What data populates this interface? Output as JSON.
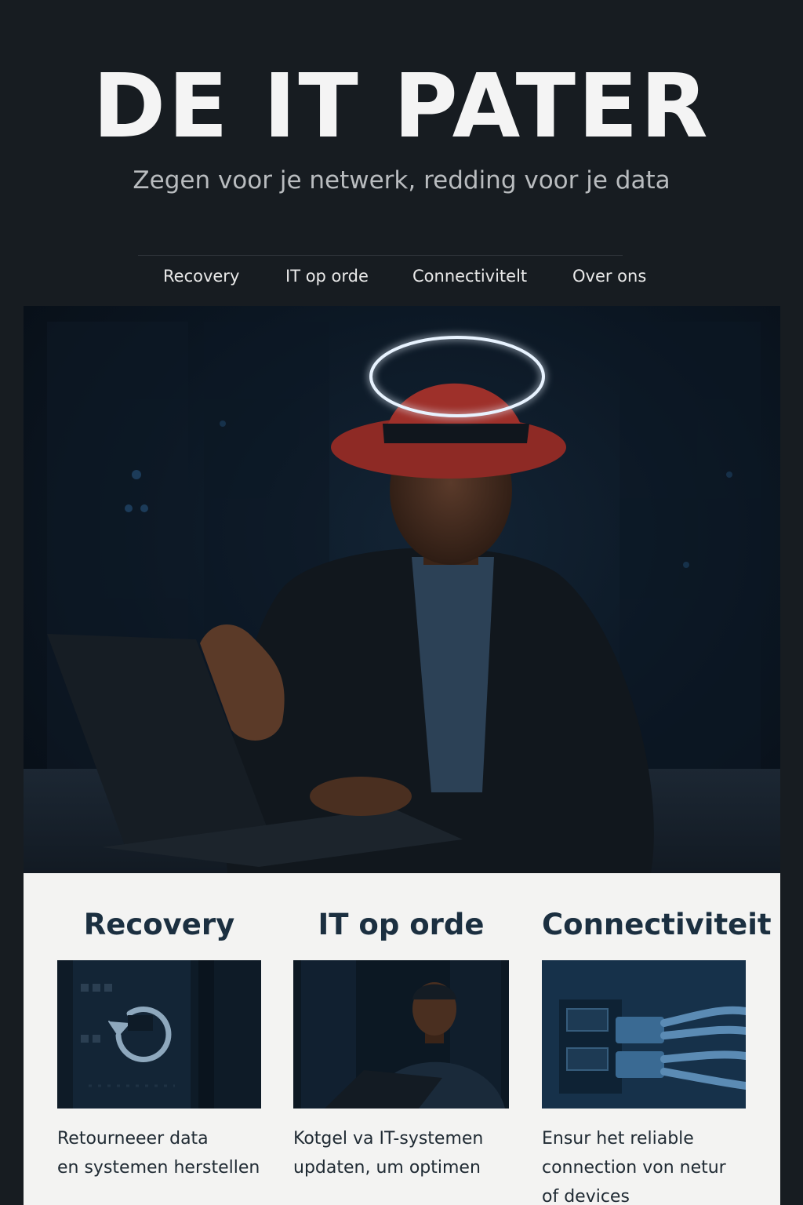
{
  "header": {
    "title": "DE IT PATER",
    "tagline": "Zegen voor je netwerk, redding voor je data"
  },
  "nav": {
    "items": [
      {
        "label": "Recovery"
      },
      {
        "label": "IT op orde"
      },
      {
        "label": "Connectivitelt"
      },
      {
        "label": "Over ons"
      }
    ]
  },
  "hero": {
    "image": "man-with-red-hat-and-halo-at-laptop"
  },
  "services": [
    {
      "title": "Recovery",
      "image": "server-rack-with-recovery-icon",
      "desc_line1": "Retourneeer data",
      "desc_line2": "en systemen herstellen",
      "desc_line3": ""
    },
    {
      "title": "IT op orde",
      "image": "man-at-laptop-in-server-room",
      "desc_line1": "Kotgel va IT-systemen",
      "desc_line2": "updaten, um optimen",
      "desc_line3": ""
    },
    {
      "title": "Connectiviteit",
      "image": "network-cables-plugged-into-switch",
      "desc_line1": "Ensur het reliable",
      "desc_line2": "connection von netur",
      "desc_line3": "of devices"
    }
  ],
  "colors": {
    "page_bg": "#171c21",
    "card_bg": "#f3f3f2",
    "heading_dark": "#1b2f40",
    "hat_red": "#a8322c",
    "halo": "#e8f3ff"
  }
}
